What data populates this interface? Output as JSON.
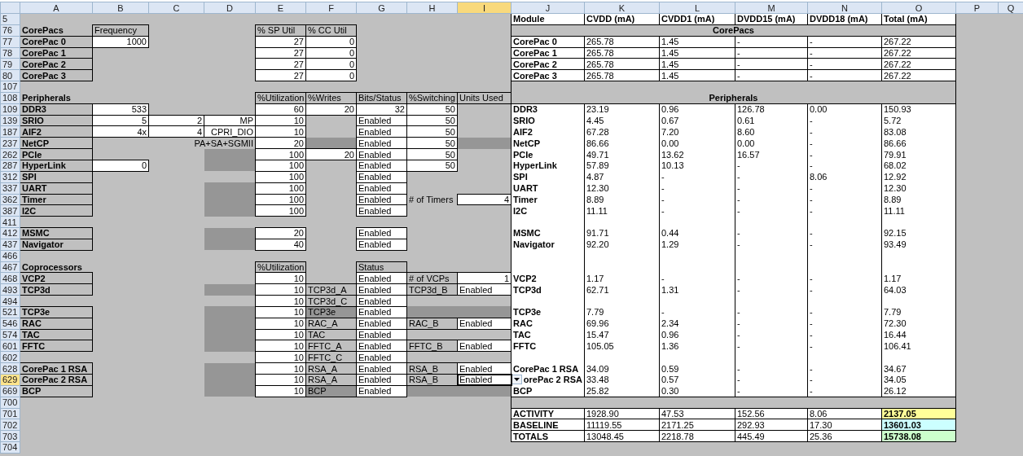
{
  "columns": [
    {
      "label": "A",
      "selected": false
    },
    {
      "label": "B",
      "selected": false
    },
    {
      "label": "C",
      "selected": false
    },
    {
      "label": "D",
      "selected": false
    },
    {
      "label": "E",
      "selected": false
    },
    {
      "label": "F",
      "selected": false
    },
    {
      "label": "G",
      "selected": false
    },
    {
      "label": "H",
      "selected": false
    },
    {
      "label": "I",
      "selected": true
    },
    {
      "label": "J",
      "selected": false
    },
    {
      "label": "K",
      "selected": false
    },
    {
      "label": "L",
      "selected": false
    },
    {
      "label": "M",
      "selected": false
    },
    {
      "label": "N",
      "selected": false
    },
    {
      "label": "O",
      "selected": false
    },
    {
      "label": "P",
      "selected": false
    },
    {
      "label": "Q",
      "selected": false
    }
  ],
  "rows": [
    {
      "number": "5",
      "selected": false,
      "cells": {
        "J": {
          "kind": "r-head",
          "text": "Module"
        },
        "K": {
          "kind": "r-head",
          "text": "CVDD (mA)"
        },
        "L": {
          "kind": "r-head",
          "text": "CVDD1 (mA)"
        },
        "M": {
          "kind": "r-head",
          "text": "DVDD15 (mA)"
        },
        "N": {
          "kind": "r-head",
          "text": "DVDD18 (mA)"
        },
        "O": {
          "kind": "r-head",
          "text": "Total (mA)"
        }
      }
    },
    {
      "number": "76",
      "selected": false,
      "cells": {
        "A": {
          "kind": "heading",
          "text": "CorePacs"
        },
        "B": {
          "kind": "header",
          "text": "Frequency"
        },
        "E": {
          "kind": "header",
          "text": "% SP Util"
        },
        "F": {
          "kind": "header",
          "text": "% CC Util"
        },
        "J": {
          "kind": "band",
          "text": "CorePacs"
        }
      }
    },
    {
      "number": "77",
      "selected": false,
      "cells": {
        "A": {
          "kind": "label",
          "text": "CorePac 0"
        },
        "B": {
          "kind": "input",
          "text": "1000"
        },
        "E": {
          "kind": "input",
          "text": "27"
        },
        "F": {
          "kind": "input",
          "text": "0"
        },
        "J": {
          "kind": "r-box-bold",
          "text": "CorePac 0"
        },
        "K": {
          "kind": "r-box",
          "text": "265.78"
        },
        "L": {
          "kind": "r-box",
          "text": "1.45"
        },
        "M": {
          "kind": "r-box",
          "text": "-"
        },
        "N": {
          "kind": "r-box",
          "text": "-"
        },
        "O": {
          "kind": "r-box",
          "text": "267.22"
        }
      }
    },
    {
      "number": "78",
      "selected": false,
      "cells": {
        "A": {
          "kind": "label",
          "text": "CorePac 1"
        },
        "E": {
          "kind": "input",
          "text": "27"
        },
        "F": {
          "kind": "input",
          "text": "0"
        },
        "J": {
          "kind": "r-box-bold",
          "text": "CorePac 1"
        },
        "K": {
          "kind": "r-box",
          "text": "265.78"
        },
        "L": {
          "kind": "r-box",
          "text": "1.45"
        },
        "M": {
          "kind": "r-box",
          "text": "-"
        },
        "N": {
          "kind": "r-box",
          "text": "-"
        },
        "O": {
          "kind": "r-box",
          "text": "267.22"
        }
      }
    },
    {
      "number": "79",
      "selected": false,
      "cells": {
        "A": {
          "kind": "label",
          "text": "CorePac 2"
        },
        "E": {
          "kind": "input",
          "text": "27"
        },
        "F": {
          "kind": "input",
          "text": "0"
        },
        "J": {
          "kind": "r-box-bold",
          "text": "CorePac 2"
        },
        "K": {
          "kind": "r-box",
          "text": "265.78"
        },
        "L": {
          "kind": "r-box",
          "text": "1.45"
        },
        "M": {
          "kind": "r-box",
          "text": "-"
        },
        "N": {
          "kind": "r-box",
          "text": "-"
        },
        "O": {
          "kind": "r-box",
          "text": "267.22"
        }
      }
    },
    {
      "number": "80",
      "selected": false,
      "cells": {
        "A": {
          "kind": "label",
          "text": "CorePac 3"
        },
        "E": {
          "kind": "input",
          "text": "27"
        },
        "F": {
          "kind": "input",
          "text": "0"
        },
        "J": {
          "kind": "r-box-bold",
          "text": "CorePac 3"
        },
        "K": {
          "kind": "r-box",
          "text": "265.78"
        },
        "L": {
          "kind": "r-box",
          "text": "1.45"
        },
        "M": {
          "kind": "r-box",
          "text": "-"
        },
        "N": {
          "kind": "r-box",
          "text": "-"
        },
        "O": {
          "kind": "r-box",
          "text": "267.22"
        }
      }
    },
    {
      "number": "107",
      "selected": false,
      "cells": {
        "J": {
          "kind": "band-top"
        }
      }
    },
    {
      "number": "108",
      "selected": false,
      "cells": {
        "A": {
          "kind": "heading",
          "text": "Peripherals"
        },
        "E": {
          "kind": "header",
          "text": "%Utilization"
        },
        "F": {
          "kind": "header",
          "text": "%Writes"
        },
        "G": {
          "kind": "header",
          "text": "Bits/Status"
        },
        "H": {
          "kind": "header",
          "text": "%Switching"
        },
        "I": {
          "kind": "header",
          "text": "Units Used"
        },
        "J": {
          "kind": "band-bottom",
          "text": "Peripherals"
        }
      }
    },
    {
      "number": "109",
      "selected": false,
      "cells": {
        "A": {
          "kind": "label",
          "text": "DDR3"
        },
        "B": {
          "kind": "input",
          "text": "533"
        },
        "E": {
          "kind": "input",
          "text": "60"
        },
        "F": {
          "kind": "input",
          "text": "20"
        },
        "G": {
          "kind": "input",
          "text": "32"
        },
        "H": {
          "kind": "input",
          "text": "50"
        },
        "J": {
          "kind": "r-col-bold",
          "text": "DDR3"
        },
        "K": {
          "kind": "r-col",
          "text": "23.19"
        },
        "L": {
          "kind": "r-col",
          "text": "0.96"
        },
        "M": {
          "kind": "r-col",
          "text": "126.78"
        },
        "N": {
          "kind": "r-col",
          "text": "0.00"
        },
        "O": {
          "kind": "r-col",
          "text": "150.93"
        }
      }
    },
    {
      "number": "139",
      "selected": false,
      "cells": {
        "A": {
          "kind": "label",
          "text": "SRIO"
        },
        "B": {
          "kind": "input",
          "text": "5"
        },
        "C": {
          "kind": "input",
          "text": "2"
        },
        "D": {
          "kind": "input",
          "text": "MP"
        },
        "E": {
          "kind": "input",
          "text": "10"
        },
        "G": {
          "kind": "status",
          "text": "Enabled"
        },
        "H": {
          "kind": "input",
          "text": "50"
        },
        "J": {
          "kind": "r-col-bold",
          "text": "SRIO"
        },
        "K": {
          "kind": "r-col",
          "text": "4.45"
        },
        "L": {
          "kind": "r-col",
          "text": "0.67"
        },
        "M": {
          "kind": "r-col",
          "text": "0.61"
        },
        "N": {
          "kind": "r-col",
          "text": "-"
        },
        "O": {
          "kind": "r-col",
          "text": "5.72"
        }
      }
    },
    {
      "number": "187",
      "selected": false,
      "cells": {
        "A": {
          "kind": "label",
          "text": "AIF2"
        },
        "B": {
          "kind": "input",
          "text": "4x"
        },
        "C": {
          "kind": "input",
          "text": "4"
        },
        "D": {
          "kind": "input",
          "text": "CPRI_DIO"
        },
        "E": {
          "kind": "input",
          "text": "10"
        },
        "G": {
          "kind": "status",
          "text": "Enabled"
        },
        "H": {
          "kind": "input",
          "text": "50"
        },
        "J": {
          "kind": "r-col-bold",
          "text": "AIF2"
        },
        "K": {
          "kind": "r-col",
          "text": "67.28"
        },
        "L": {
          "kind": "r-col",
          "text": "7.20"
        },
        "M": {
          "kind": "r-col",
          "text": "8.60"
        },
        "N": {
          "kind": "r-col",
          "text": "-"
        },
        "O": {
          "kind": "r-col",
          "text": "83.08"
        }
      }
    },
    {
      "number": "237",
      "selected": false,
      "cells": {
        "A": {
          "kind": "label",
          "text": "NetCP"
        },
        "C": {
          "kind": "wide-note",
          "text": "PA+SA+SGMII"
        },
        "E": {
          "kind": "input",
          "text": "20"
        },
        "F": {
          "kind": "dark"
        },
        "G": {
          "kind": "status",
          "text": "Enabled"
        },
        "H": {
          "kind": "input",
          "text": "50"
        },
        "I": {
          "kind": "dark"
        },
        "J": {
          "kind": "r-col-bold",
          "text": "NetCP"
        },
        "K": {
          "kind": "r-col",
          "text": "86.66"
        },
        "L": {
          "kind": "r-col",
          "text": "0.00"
        },
        "M": {
          "kind": "r-col",
          "text": "0.00"
        },
        "N": {
          "kind": "r-col",
          "text": "-"
        },
        "O": {
          "kind": "r-col",
          "text": "86.66"
        }
      }
    },
    {
      "number": "262",
      "selected": false,
      "cells": {
        "A": {
          "kind": "label",
          "text": "PCIe"
        },
        "D": {
          "kind": "dark"
        },
        "E": {
          "kind": "input",
          "text": "100"
        },
        "F": {
          "kind": "input",
          "text": "20"
        },
        "G": {
          "kind": "status",
          "text": "Enabled"
        },
        "H": {
          "kind": "input",
          "text": "50"
        },
        "J": {
          "kind": "r-col-bold",
          "text": "PCIe"
        },
        "K": {
          "kind": "r-col",
          "text": "49.71"
        },
        "L": {
          "kind": "r-col",
          "text": "13.62"
        },
        "M": {
          "kind": "r-col",
          "text": "16.57"
        },
        "N": {
          "kind": "r-col",
          "text": "-"
        },
        "O": {
          "kind": "r-col",
          "text": "79.91"
        }
      }
    },
    {
      "number": "287",
      "selected": false,
      "cells": {
        "A": {
          "kind": "label",
          "text": "HyperLink"
        },
        "B": {
          "kind": "input",
          "text": "0"
        },
        "D": {
          "kind": "dark"
        },
        "E": {
          "kind": "input",
          "text": "100"
        },
        "G": {
          "kind": "status",
          "text": "Enabled"
        },
        "H": {
          "kind": "input",
          "text": "50"
        },
        "J": {
          "kind": "r-col-bold",
          "text": "HyperLink"
        },
        "K": {
          "kind": "r-col",
          "text": "57.89"
        },
        "L": {
          "kind": "r-col",
          "text": "10.13"
        },
        "M": {
          "kind": "r-col",
          "text": "-"
        },
        "N": {
          "kind": "r-col",
          "text": "-"
        },
        "O": {
          "kind": "r-col",
          "text": "68.02"
        }
      }
    },
    {
      "number": "312",
      "selected": false,
      "cells": {
        "A": {
          "kind": "label",
          "text": "SPI"
        },
        "E": {
          "kind": "input",
          "text": "100"
        },
        "G": {
          "kind": "status",
          "text": "Enabled"
        },
        "J": {
          "kind": "r-col-bold",
          "text": "SPI"
        },
        "K": {
          "kind": "r-col",
          "text": "4.87"
        },
        "L": {
          "kind": "r-col",
          "text": "-"
        },
        "M": {
          "kind": "r-col",
          "text": "-"
        },
        "N": {
          "kind": "r-col",
          "text": "8.06"
        },
        "O": {
          "kind": "r-col",
          "text": "12.92"
        }
      }
    },
    {
      "number": "337",
      "selected": false,
      "cells": {
        "A": {
          "kind": "label",
          "text": "UART"
        },
        "D": {
          "kind": "dark"
        },
        "E": {
          "kind": "input",
          "text": "100"
        },
        "G": {
          "kind": "status",
          "text": "Enabled"
        },
        "J": {
          "kind": "r-col-bold",
          "text": "UART"
        },
        "K": {
          "kind": "r-col",
          "text": "12.30"
        },
        "L": {
          "kind": "r-col",
          "text": "-"
        },
        "M": {
          "kind": "r-col",
          "text": "-"
        },
        "N": {
          "kind": "r-col",
          "text": "-"
        },
        "O": {
          "kind": "r-col",
          "text": "12.30"
        }
      }
    },
    {
      "number": "362",
      "selected": false,
      "cells": {
        "A": {
          "kind": "label",
          "text": "Timer"
        },
        "D": {
          "kind": "dark"
        },
        "E": {
          "kind": "input",
          "text": "100"
        },
        "G": {
          "kind": "status",
          "text": "Enabled"
        },
        "H": {
          "kind": "note",
          "text": "# of Timers"
        },
        "I": {
          "kind": "input",
          "text": "4"
        },
        "J": {
          "kind": "r-col-bold",
          "text": "Timer"
        },
        "K": {
          "kind": "r-col",
          "text": "8.89"
        },
        "L": {
          "kind": "r-col",
          "text": "-"
        },
        "M": {
          "kind": "r-col",
          "text": "-"
        },
        "N": {
          "kind": "r-col",
          "text": "-"
        },
        "O": {
          "kind": "r-col",
          "text": "8.89"
        }
      }
    },
    {
      "number": "387",
      "selected": false,
      "cells": {
        "A": {
          "kind": "label",
          "text": "I2C"
        },
        "D": {
          "kind": "dark"
        },
        "E": {
          "kind": "input",
          "text": "100"
        },
        "G": {
          "kind": "status",
          "text": "Enabled"
        },
        "J": {
          "kind": "r-col-bold",
          "text": "I2C"
        },
        "K": {
          "kind": "r-col",
          "text": "11.11"
        },
        "L": {
          "kind": "r-col",
          "text": "-"
        },
        "M": {
          "kind": "r-col",
          "text": "-"
        },
        "N": {
          "kind": "r-col",
          "text": "-"
        },
        "O": {
          "kind": "r-col",
          "text": "11.11"
        }
      }
    },
    {
      "number": "411",
      "selected": false,
      "cells": {
        "J": {
          "kind": "r-col"
        },
        "K": {
          "kind": "r-col"
        },
        "L": {
          "kind": "r-col"
        },
        "M": {
          "kind": "r-col"
        },
        "N": {
          "kind": "r-col"
        },
        "O": {
          "kind": "r-col"
        }
      }
    },
    {
      "number": "412",
      "selected": false,
      "cells": {
        "A": {
          "kind": "label",
          "text": "MSMC"
        },
        "D": {
          "kind": "dark"
        },
        "E": {
          "kind": "input",
          "text": "20"
        },
        "G": {
          "kind": "status",
          "text": "Enabled"
        },
        "J": {
          "kind": "r-col-bold",
          "text": "MSMC"
        },
        "K": {
          "kind": "r-col",
          "text": "91.71"
        },
        "L": {
          "kind": "r-col",
          "text": "0.44"
        },
        "M": {
          "kind": "r-col",
          "text": "-"
        },
        "N": {
          "kind": "r-col",
          "text": "-"
        },
        "O": {
          "kind": "r-col",
          "text": "92.15"
        }
      }
    },
    {
      "number": "437",
      "selected": false,
      "cells": {
        "A": {
          "kind": "label",
          "text": "Navigator"
        },
        "D": {
          "kind": "dark"
        },
        "E": {
          "kind": "input",
          "text": "40"
        },
        "G": {
          "kind": "status",
          "text": "Enabled"
        },
        "J": {
          "kind": "r-col-bold",
          "text": "Navigator"
        },
        "K": {
          "kind": "r-col",
          "text": "92.20"
        },
        "L": {
          "kind": "r-col",
          "text": "1.29"
        },
        "M": {
          "kind": "r-col",
          "text": "-"
        },
        "N": {
          "kind": "r-col",
          "text": "-"
        },
        "O": {
          "kind": "r-col",
          "text": "93.49"
        }
      }
    },
    {
      "number": "466",
      "selected": false,
      "cells": {
        "J": {
          "kind": "r-col"
        },
        "K": {
          "kind": "r-col"
        },
        "L": {
          "kind": "r-col"
        },
        "M": {
          "kind": "r-col"
        },
        "N": {
          "kind": "r-col"
        },
        "O": {
          "kind": "r-col"
        }
      }
    },
    {
      "number": "467",
      "selected": false,
      "cells": {
        "A": {
          "kind": "heading",
          "text": "Coprocessors"
        },
        "E": {
          "kind": "header",
          "text": "%Utilization"
        },
        "G": {
          "kind": "header",
          "text": "Status"
        },
        "J": {
          "kind": "r-col"
        },
        "K": {
          "kind": "r-col"
        },
        "L": {
          "kind": "r-col"
        },
        "M": {
          "kind": "r-col"
        },
        "N": {
          "kind": "r-col"
        },
        "O": {
          "kind": "r-col"
        }
      }
    },
    {
      "number": "468",
      "selected": false,
      "cells": {
        "A": {
          "kind": "label",
          "text": "VCP2"
        },
        "E": {
          "kind": "input",
          "text": "10"
        },
        "G": {
          "kind": "status",
          "text": "Enabled"
        },
        "H": {
          "kind": "header",
          "text": "# of VCPs"
        },
        "I": {
          "kind": "input",
          "text": "1"
        },
        "J": {
          "kind": "r-col-bold",
          "text": "VCP2"
        },
        "K": {
          "kind": "r-col",
          "text": "1.17"
        },
        "L": {
          "kind": "r-col",
          "text": "-"
        },
        "M": {
          "kind": "r-col",
          "text": "-"
        },
        "N": {
          "kind": "r-col",
          "text": "-"
        },
        "O": {
          "kind": "r-col",
          "text": "1.17"
        }
      }
    },
    {
      "number": "493",
      "selected": false,
      "cells": {
        "A": {
          "kind": "label",
          "text": "TCP3d"
        },
        "D": {
          "kind": "dark"
        },
        "E": {
          "kind": "input",
          "text": "10"
        },
        "F": {
          "kind": "header",
          "text": "TCP3d_A"
        },
        "G": {
          "kind": "status",
          "text": "Enabled"
        },
        "H": {
          "kind": "header",
          "text": "TCP3d_B"
        },
        "I": {
          "kind": "status",
          "text": "Enabled"
        },
        "J": {
          "kind": "r-col-bold",
          "text": "TCP3d"
        },
        "K": {
          "kind": "r-col",
          "text": "62.71"
        },
        "L": {
          "kind": "r-col",
          "text": "1.31"
        },
        "M": {
          "kind": "r-col",
          "text": "-"
        },
        "N": {
          "kind": "r-col",
          "text": "-"
        },
        "O": {
          "kind": "r-col",
          "text": "64.03"
        }
      }
    },
    {
      "number": "494",
      "selected": false,
      "cells": {
        "E": {
          "kind": "input",
          "text": "10"
        },
        "F": {
          "kind": "header",
          "text": "TCP3d_C"
        },
        "G": {
          "kind": "status",
          "text": "Enabled"
        },
        "J": {
          "kind": "r-col"
        },
        "K": {
          "kind": "r-col"
        },
        "L": {
          "kind": "r-col"
        },
        "M": {
          "kind": "r-col"
        },
        "N": {
          "kind": "r-col"
        },
        "O": {
          "kind": "r-col"
        }
      }
    },
    {
      "number": "521",
      "selected": false,
      "cells": {
        "A": {
          "kind": "label",
          "text": "TCP3e"
        },
        "D": {
          "kind": "dark"
        },
        "E": {
          "kind": "input",
          "text": "10"
        },
        "F": {
          "kind": "dark-box",
          "text": "TCP3e"
        },
        "G": {
          "kind": "status",
          "text": "Enabled"
        },
        "H": {
          "kind": "dark"
        },
        "I": {
          "kind": "dark"
        },
        "J": {
          "kind": "r-col-bold",
          "text": "TCP3e"
        },
        "K": {
          "kind": "r-col",
          "text": "7.79"
        },
        "L": {
          "kind": "r-col",
          "text": "-"
        },
        "M": {
          "kind": "r-col",
          "text": "-"
        },
        "N": {
          "kind": "r-col",
          "text": "-"
        },
        "O": {
          "kind": "r-col",
          "text": "7.79"
        }
      }
    },
    {
      "number": "546",
      "selected": false,
      "cells": {
        "A": {
          "kind": "label",
          "text": "RAC"
        },
        "D": {
          "kind": "dark"
        },
        "E": {
          "kind": "input",
          "text": "10"
        },
        "F": {
          "kind": "header",
          "text": "RAC_A"
        },
        "G": {
          "kind": "status",
          "text": "Enabled"
        },
        "H": {
          "kind": "header",
          "text": "RAC_B"
        },
        "I": {
          "kind": "status",
          "text": "Enabled"
        },
        "J": {
          "kind": "r-col-bold",
          "text": "RAC"
        },
        "K": {
          "kind": "r-col",
          "text": "69.96"
        },
        "L": {
          "kind": "r-col",
          "text": "2.34"
        },
        "M": {
          "kind": "r-col",
          "text": "-"
        },
        "N": {
          "kind": "r-col",
          "text": "-"
        },
        "O": {
          "kind": "r-col",
          "text": "72.30"
        }
      }
    },
    {
      "number": "574",
      "selected": false,
      "cells": {
        "A": {
          "kind": "label",
          "text": "TAC"
        },
        "D": {
          "kind": "dark"
        },
        "E": {
          "kind": "input",
          "text": "10"
        },
        "F": {
          "kind": "header",
          "text": "TAC"
        },
        "G": {
          "kind": "status",
          "text": "Enabled"
        },
        "J": {
          "kind": "r-col-bold",
          "text": "TAC"
        },
        "K": {
          "kind": "r-col",
          "text": "15.47"
        },
        "L": {
          "kind": "r-col",
          "text": "0.96"
        },
        "M": {
          "kind": "r-col",
          "text": "-"
        },
        "N": {
          "kind": "r-col",
          "text": "-"
        },
        "O": {
          "kind": "r-col",
          "text": "16.44"
        }
      }
    },
    {
      "number": "601",
      "selected": false,
      "cells": {
        "A": {
          "kind": "label",
          "text": "FFTC"
        },
        "D": {
          "kind": "dark"
        },
        "E": {
          "kind": "input",
          "text": "10"
        },
        "F": {
          "kind": "header",
          "text": "FFTC_A"
        },
        "G": {
          "kind": "status",
          "text": "Enabled"
        },
        "H": {
          "kind": "header",
          "text": "FFTC_B"
        },
        "I": {
          "kind": "status",
          "text": "Enabled"
        },
        "J": {
          "kind": "r-col-bold",
          "text": "FFTC"
        },
        "K": {
          "kind": "r-col",
          "text": "105.05"
        },
        "L": {
          "kind": "r-col",
          "text": "1.36"
        },
        "M": {
          "kind": "r-col",
          "text": "-"
        },
        "N": {
          "kind": "r-col",
          "text": "-"
        },
        "O": {
          "kind": "r-col",
          "text": "106.41"
        }
      }
    },
    {
      "number": "602",
      "selected": false,
      "cells": {
        "E": {
          "kind": "input",
          "text": "10"
        },
        "F": {
          "kind": "header",
          "text": "FFTC_C"
        },
        "G": {
          "kind": "status",
          "text": "Enabled"
        },
        "J": {
          "kind": "r-col"
        },
        "K": {
          "kind": "r-col"
        },
        "L": {
          "kind": "r-col"
        },
        "M": {
          "kind": "r-col"
        },
        "N": {
          "kind": "r-col"
        },
        "O": {
          "kind": "r-col"
        }
      }
    },
    {
      "number": "628",
      "selected": false,
      "cells": {
        "A": {
          "kind": "label",
          "text": "CorePac 1 RSA"
        },
        "D": {
          "kind": "dark"
        },
        "E": {
          "kind": "input",
          "text": "10"
        },
        "F": {
          "kind": "header",
          "text": "RSA_A"
        },
        "G": {
          "kind": "status",
          "text": "Enabled"
        },
        "H": {
          "kind": "header",
          "text": "RSA_B"
        },
        "I": {
          "kind": "status",
          "text": "Enabled"
        },
        "J": {
          "kind": "r-col-bold",
          "text": "CorePac 1 RSA"
        },
        "K": {
          "kind": "r-col",
          "text": "34.09"
        },
        "L": {
          "kind": "r-col",
          "text": "0.59"
        },
        "M": {
          "kind": "r-col",
          "text": "-"
        },
        "N": {
          "kind": "r-col",
          "text": "-"
        },
        "O": {
          "kind": "r-col",
          "text": "34.67"
        }
      }
    },
    {
      "number": "629",
      "selected": true,
      "cells": {
        "A": {
          "kind": "label",
          "text": "CorePac 2 RSA"
        },
        "D": {
          "kind": "dark"
        },
        "E": {
          "kind": "input",
          "text": "10"
        },
        "F": {
          "kind": "header",
          "text": "RSA_A"
        },
        "G": {
          "kind": "status",
          "text": "Enabled"
        },
        "H": {
          "kind": "header",
          "text": "RSA_B"
        },
        "I": {
          "kind": "status",
          "text": "Enabled"
        },
        "J": {
          "kind": "r-col-dropdown",
          "text": "orePac 2 RSA"
        },
        "K": {
          "kind": "r-col",
          "text": "33.48"
        },
        "L": {
          "kind": "r-col",
          "text": "0.57"
        },
        "M": {
          "kind": "r-col",
          "text": "-"
        },
        "N": {
          "kind": "r-col",
          "text": "-"
        },
        "O": {
          "kind": "r-col",
          "text": "34.05"
        }
      }
    },
    {
      "number": "669",
      "selected": false,
      "cells": {
        "A": {
          "kind": "label",
          "text": "BCP"
        },
        "D": {
          "kind": "dark"
        },
        "E": {
          "kind": "input",
          "text": "10"
        },
        "F": {
          "kind": "dark-box",
          "text": "BCP"
        },
        "G": {
          "kind": "status",
          "text": "Enabled"
        },
        "H": {
          "kind": "dark"
        },
        "I": {
          "kind": "dark"
        },
        "J": {
          "kind": "r-col-bold",
          "text": "BCP"
        },
        "K": {
          "kind": "r-col",
          "text": "25.82"
        },
        "L": {
          "kind": "r-col",
          "text": "0.30"
        },
        "M": {
          "kind": "r-col",
          "text": "-"
        },
        "N": {
          "kind": "r-col",
          "text": "-"
        },
        "O": {
          "kind": "r-col",
          "text": "26.12"
        }
      }
    },
    {
      "number": "700",
      "selected": false,
      "cells": {
        "J": {
          "kind": "band"
        }
      }
    },
    {
      "number": "701",
      "selected": false,
      "cells": {
        "J": {
          "kind": "r-box-bold",
          "text": "ACTIVITY"
        },
        "K": {
          "kind": "r-box",
          "text": "1928.90"
        },
        "L": {
          "kind": "r-box",
          "text": "47.53"
        },
        "M": {
          "kind": "r-box",
          "text": "152.56"
        },
        "N": {
          "kind": "r-box",
          "text": "8.06"
        },
        "O": {
          "kind": "r-total",
          "text": "2137.05",
          "color": "#ffff99"
        }
      }
    },
    {
      "number": "702",
      "selected": false,
      "cells": {
        "J": {
          "kind": "r-box-bold",
          "text": "BASELINE"
        },
        "K": {
          "kind": "r-box",
          "text": "11119.55"
        },
        "L": {
          "kind": "r-box",
          "text": "2171.25"
        },
        "M": {
          "kind": "r-box",
          "text": "292.93"
        },
        "N": {
          "kind": "r-box",
          "text": "17.30"
        },
        "O": {
          "kind": "r-total",
          "text": "13601.03",
          "color": "#ccffff"
        }
      }
    },
    {
      "number": "703",
      "selected": false,
      "cells": {
        "J": {
          "kind": "r-box-bold",
          "text": "TOTALS"
        },
        "K": {
          "kind": "r-box",
          "text": "13048.45"
        },
        "L": {
          "kind": "r-box",
          "text": "2218.78"
        },
        "M": {
          "kind": "r-box",
          "text": "445.49"
        },
        "N": {
          "kind": "r-box",
          "text": "25.36"
        },
        "O": {
          "kind": "r-total",
          "text": "15738.08",
          "color": "#ccffcc"
        }
      }
    },
    {
      "number": "704",
      "selected": false,
      "cells": {}
    }
  ]
}
